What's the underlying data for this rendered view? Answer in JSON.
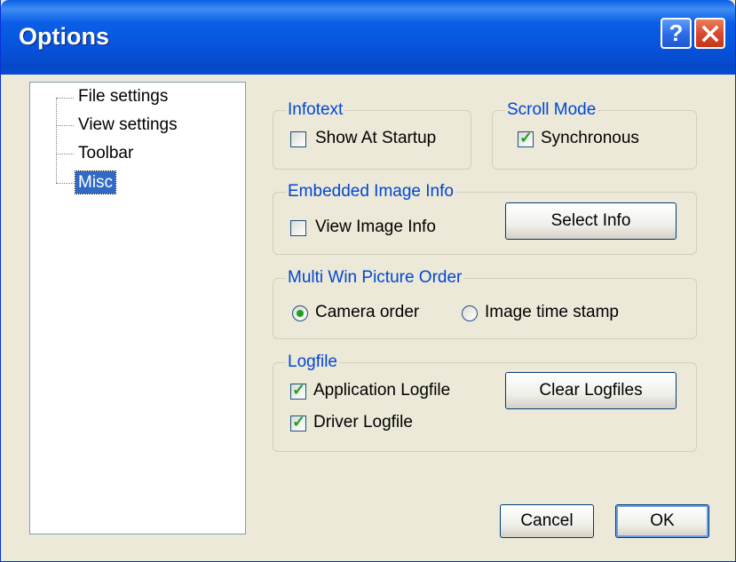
{
  "window": {
    "title": "Options",
    "help_label": "?"
  },
  "tree": {
    "items": [
      {
        "label": "File settings",
        "selected": false
      },
      {
        "label": "View settings",
        "selected": false
      },
      {
        "label": "Toolbar",
        "selected": false
      },
      {
        "label": "Misc",
        "selected": true
      }
    ]
  },
  "infotext": {
    "legend": "Infotext",
    "show_at_startup": {
      "label": "Show At Startup",
      "checked": false
    }
  },
  "scroll_mode": {
    "legend": "Scroll Mode",
    "synchronous": {
      "label": "Synchronous",
      "checked": true
    }
  },
  "embedded": {
    "legend": "Embedded Image Info",
    "view_image_info": {
      "label": "View Image Info",
      "checked": false
    },
    "select_info_label": "Select Info"
  },
  "order": {
    "legend": "Multi Win Picture Order",
    "camera": {
      "label": "Camera order",
      "selected": true
    },
    "timestamp": {
      "label": "Image time stamp",
      "selected": false
    }
  },
  "logfile": {
    "legend": "Logfile",
    "application": {
      "label": "Application Logfile",
      "checked": true
    },
    "driver": {
      "label": "Driver Logfile",
      "checked": true
    },
    "clear_label": "Clear Logfiles"
  },
  "buttons": {
    "cancel": "Cancel",
    "ok": "OK"
  },
  "colors": {
    "title_bar": "#0a5fe6",
    "group_title": "#0046d5",
    "selection": "#316ac5",
    "check": "#21a121",
    "face": "#ece9d8"
  }
}
